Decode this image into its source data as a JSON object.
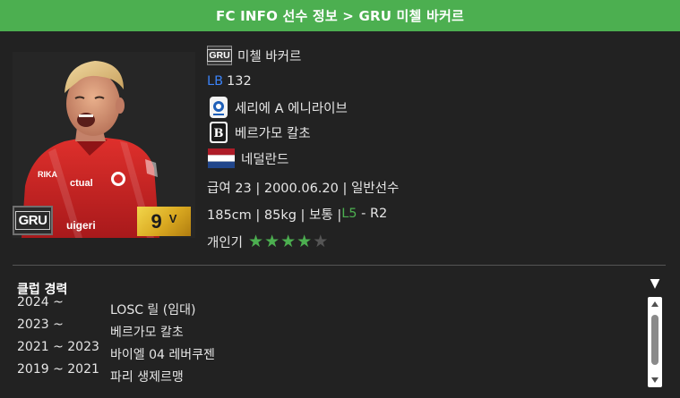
{
  "header": {
    "title": "FC INFO 선수 정보 > GRU 미첼 바커르"
  },
  "card": {
    "season": "GRU",
    "grade": "9",
    "grade_suffix": "V",
    "colors": {
      "grade_gold": "#e2b52a",
      "jersey_red": "#d42a2a"
    }
  },
  "info": {
    "season": "GRU",
    "name": "미첼 바커르",
    "position": "LB",
    "ovr": "132",
    "league": "세리에 A 에니라이브",
    "club": "베르가모 칼초",
    "nation": "네덜란드",
    "detail1": "급여 23 | 2000.06.20 | 일반선수",
    "body_prefix": "185cm | 85kg | 보통 | ",
    "foot_left": "L5",
    "foot_sep": " - ",
    "foot_right": "R2",
    "popularity_label": "개인기",
    "popularity_stars": 4,
    "popularity_max": 5
  },
  "clubs": {
    "title": "클럽 경력",
    "items": [
      {
        "period": "2024 ~",
        "name": "LOSC 릴 (임대)"
      },
      {
        "period": "2023 ~",
        "name": "베르가모 칼초"
      },
      {
        "period": "2021 ~ 2023",
        "name": "바이엘 04 레버쿠젠"
      },
      {
        "period": "2019 ~ 2021",
        "name": "파리 생제르맹"
      }
    ]
  },
  "colors": {
    "header_bg": "#4caf50",
    "bg": "#222222",
    "position": "#3b82f6",
    "accent_green": "#4caf50"
  }
}
